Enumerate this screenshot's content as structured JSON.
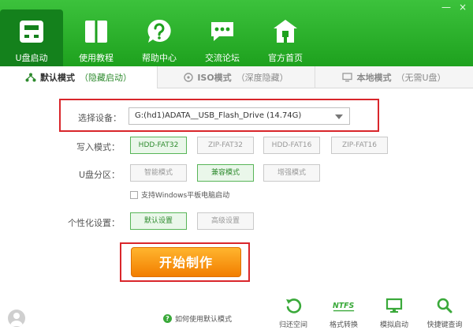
{
  "window": {
    "minimize_glyph": "—",
    "close_glyph": "×"
  },
  "nav": {
    "items": [
      {
        "label": "U盘启动",
        "icon": "usb-drive-icon",
        "active": true
      },
      {
        "label": "使用教程",
        "icon": "book-icon"
      },
      {
        "label": "帮助中心",
        "icon": "help-icon"
      },
      {
        "label": "交流论坛",
        "icon": "chat-icon"
      },
      {
        "label": "官方首页",
        "icon": "home-icon"
      }
    ]
  },
  "tabs": [
    {
      "main": "默认模式",
      "sub": "（隐藏启动）",
      "icon": "tree-icon",
      "active": true
    },
    {
      "main": "ISO模式",
      "sub": "（深度隐藏）",
      "icon": "disc-icon"
    },
    {
      "main": "本地模式",
      "sub": "（无需U盘）",
      "icon": "monitor-icon"
    }
  ],
  "form": {
    "device_label": "选择设备：",
    "device_value": "G:(hd1)ADATA__USB_Flash_Drive (14.74G)",
    "write_label": "写入模式：",
    "write_options": [
      "HDD-FAT32",
      "ZIP-FAT32",
      "HDD-FAT16",
      "ZIP-FAT16"
    ],
    "partition_label": "U盘分区：",
    "partition_options": [
      "智能模式",
      "兼容模式",
      "增强模式"
    ],
    "checkbox_label": "支持Windows平板电脑启动",
    "custom_label": "个性化设置：",
    "custom_options": [
      "默认设置",
      "高级设置"
    ],
    "start_label": "开始制作"
  },
  "bottom": {
    "help_text": "如何使用默认模式",
    "tools": [
      {
        "label": "归还空间",
        "icon": "restore-icon"
      },
      {
        "label": "格式转换",
        "icon": "ntfs-icon",
        "icon_text": "NTFS"
      },
      {
        "label": "模拟启动",
        "icon": "simulate-monitor-icon"
      },
      {
        "label": "快捷键查询",
        "icon": "search-icon"
      }
    ]
  },
  "colors": {
    "header": "#1ea11e",
    "active_nav": "#14811c",
    "accent": "#2e8b2e",
    "highlight": "#d9262b",
    "start": "#f27e00"
  }
}
